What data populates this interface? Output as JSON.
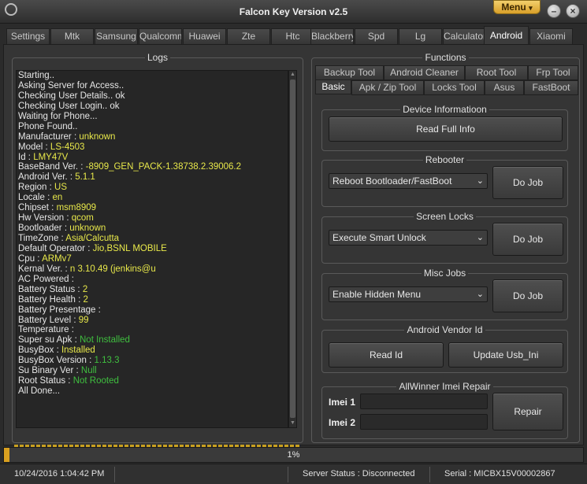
{
  "window": {
    "title": "Falcon Key Version v2.5",
    "menu_label": "Menu",
    "menu_caret": "▾",
    "minimize_glyph": "–",
    "close_glyph": "×"
  },
  "tabs": [
    {
      "label": "Settings"
    },
    {
      "label": "Mtk"
    },
    {
      "label": "Samsung"
    },
    {
      "label": "Qualcomm"
    },
    {
      "label": "Huawei"
    },
    {
      "label": "Zte"
    },
    {
      "label": "Htc"
    },
    {
      "label": "Blackberry"
    },
    {
      "label": "Spd"
    },
    {
      "label": "Lg"
    },
    {
      "label": "Calculator"
    },
    {
      "label": "Android",
      "active": true
    },
    {
      "label": "Xiaomi"
    }
  ],
  "logs": {
    "title": "Logs",
    "lines": [
      {
        "k": "Starting..",
        "v": "",
        "c": ""
      },
      {
        "k": "Asking Server for Access..",
        "v": "",
        "c": ""
      },
      {
        "k": "Checking User Details.. ok",
        "v": "",
        "c": ""
      },
      {
        "k": "Checking User Login.. ok",
        "v": "",
        "c": ""
      },
      {
        "k": "Waiting for Phone...",
        "v": "",
        "c": ""
      },
      {
        "k": "Phone Found..",
        "v": "",
        "c": ""
      },
      {
        "k": "Manufacturer : ",
        "v": "unknown",
        "c": "vy"
      },
      {
        "k": "Model : ",
        "v": "LS-4503",
        "c": "vy"
      },
      {
        "k": "Id : ",
        "v": "LMY47V",
        "c": "vy"
      },
      {
        "k": "BaseBand Ver. : ",
        "v": "-8909_GEN_PACK-1.38738.2.39006.2",
        "c": "vy"
      },
      {
        "k": "Android Ver. : ",
        "v": "5.1.1",
        "c": "vy"
      },
      {
        "k": "Region : ",
        "v": "US",
        "c": "vy"
      },
      {
        "k": "Locale : ",
        "v": "en",
        "c": "vy"
      },
      {
        "k": "Chipset : ",
        "v": "msm8909",
        "c": "vy"
      },
      {
        "k": "Hw Version : ",
        "v": "qcom",
        "c": "vy"
      },
      {
        "k": "Bootloader : ",
        "v": "unknown",
        "c": "vy"
      },
      {
        "k": "TimeZone : ",
        "v": "Asia/Calcutta",
        "c": "vy"
      },
      {
        "k": "Default Operator : ",
        "v": "Jio,BSNL MOBILE",
        "c": "vy"
      },
      {
        "k": "Cpu : ",
        "v": "ARMv7",
        "c": "vy"
      },
      {
        "k": "Kernal Ver. : ",
        "v": "n 3.10.49 (jenkins@u",
        "c": "vy"
      },
      {
        "k": "AC Powered : ",
        "v": "",
        "c": ""
      },
      {
        "k": "Battery Status : ",
        "v": "2",
        "c": "vy"
      },
      {
        "k": "Battery Health : ",
        "v": "2",
        "c": "vy"
      },
      {
        "k": "Battery Presentage : ",
        "v": "",
        "c": ""
      },
      {
        "k": "Battery Level : ",
        "v": "99",
        "c": "vy"
      },
      {
        "k": "Temperature : ",
        "v": "",
        "c": ""
      },
      {
        "k": "Super su Apk : ",
        "v": "Not Installed",
        "c": "vg"
      },
      {
        "k": "BusyBox : ",
        "v": "Installed",
        "c": "vy"
      },
      {
        "k": "BusyBox Version : ",
        "v": "1.13.3",
        "c": "vg"
      },
      {
        "k": "Su Binary Ver : ",
        "v": "Null",
        "c": "vg"
      },
      {
        "k": "Root Status : ",
        "v": "Not Rooted",
        "c": "vg"
      },
      {
        "k": "All Done...",
        "v": "",
        "c": ""
      }
    ]
  },
  "functions": {
    "title": "Functions",
    "tabs_row1": [
      "Backup Tool",
      "Android Cleaner",
      "Root Tool",
      "Frp Tool"
    ],
    "tabs_row2": [
      "Basic",
      "Apk / Zip Tool",
      "Locks Tool",
      "Asus",
      "FastBoot"
    ],
    "active_tab": "Basic",
    "device_info": {
      "title": "Device Informatioon",
      "button": "Read Full Info"
    },
    "rebooter": {
      "title": "Rebooter",
      "select": "Reboot Bootloader/FastBoot",
      "button": "Do Job"
    },
    "screen_locks": {
      "title": "Screen Locks",
      "select": "Execute Smart Unlock",
      "button": "Do Job"
    },
    "misc_jobs": {
      "title": "Misc Jobs",
      "select": "Enable Hidden Menu",
      "button": "Do Job"
    },
    "vendor_id": {
      "title": "Android Vendor Id",
      "read_button": "Read Id",
      "update_button": "Update Usb_Ini"
    },
    "allwinner": {
      "title": "AllWinner Imei Repair",
      "imei1_label": "Imei 1",
      "imei2_label": "Imei 2",
      "imei1_value": "",
      "imei2_value": "",
      "button": "Repair"
    }
  },
  "progress": {
    "text": "1%",
    "value": 1
  },
  "status": {
    "datetime": "10/24/2016 1:04:42 PM",
    "server": "Server Status : Disconnected",
    "serial": "Serial : MICBX15V00002867"
  },
  "colors": {
    "accent": "#d9a020",
    "log_value_yellow": "#e8e84a",
    "log_value_green": "#3fbf3f"
  }
}
